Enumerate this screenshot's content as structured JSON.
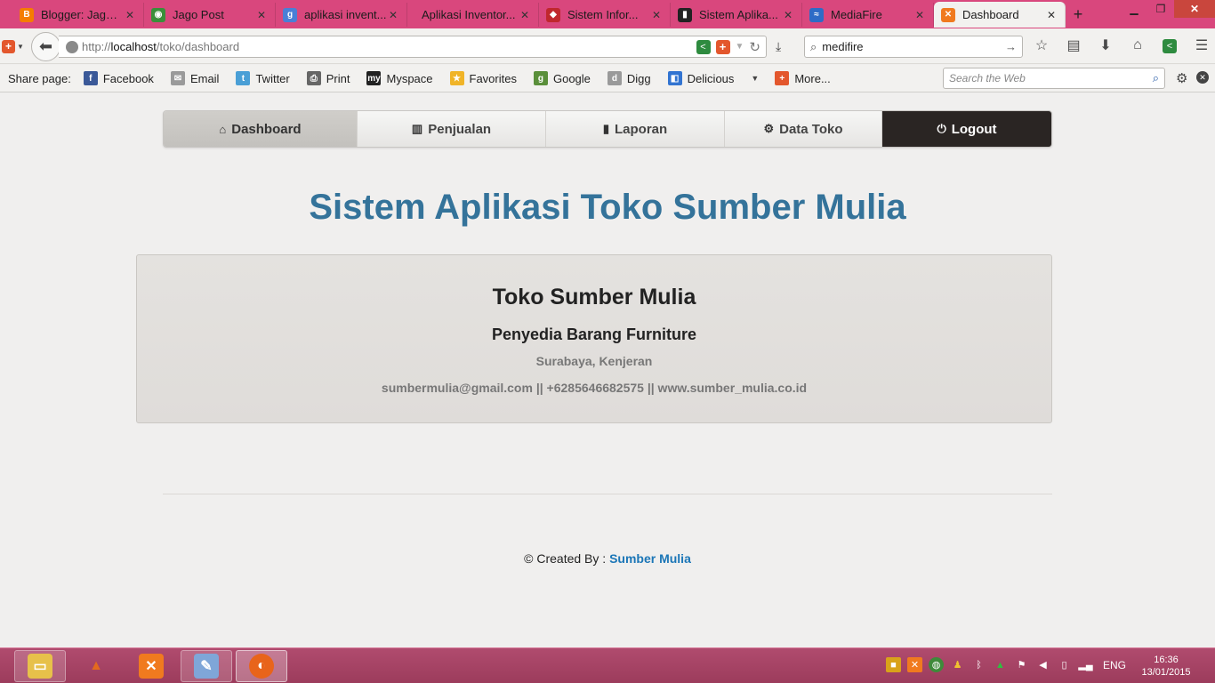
{
  "browser": {
    "tabs": [
      {
        "title": "Blogger: Jago ...",
        "icon": "blogger-icon",
        "color": "#f57d00",
        "glyph": "B"
      },
      {
        "title": "Jago Post",
        "icon": "chrome-icon",
        "color": "#3a8f3a",
        "glyph": "◉"
      },
      {
        "title": "aplikasi invent...",
        "icon": "google-icon",
        "color": "#4a7fd6",
        "glyph": "g"
      },
      {
        "title": "Aplikasi Inventor...",
        "icon": "none",
        "color": "",
        "glyph": ""
      },
      {
        "title": "Sistem Infor...",
        "icon": "site-icon",
        "color": "#c0272d",
        "glyph": "◆"
      },
      {
        "title": "Sistem Aplika...",
        "icon": "site-icon",
        "color": "#222222",
        "glyph": "▮"
      },
      {
        "title": "MediaFire",
        "icon": "mediafire-icon",
        "color": "#2e6bc6",
        "glyph": "≈"
      },
      {
        "title": "Dashboard",
        "icon": "xampp-icon",
        "color": "#f07a1f",
        "glyph": "✕"
      }
    ],
    "url_prefix": "http://",
    "url_host": "localhost",
    "url_path": "/toko/dashboard",
    "search_value": "medifire"
  },
  "sharebar": {
    "label": "Share page:",
    "items": [
      {
        "label": "Facebook",
        "icon": "facebook-icon",
        "color": "#3b5998",
        "glyph": "f"
      },
      {
        "label": "Email",
        "icon": "email-icon",
        "color": "#9a9a9a",
        "glyph": "✉"
      },
      {
        "label": "Twitter",
        "icon": "twitter-icon",
        "color": "#4a9fd6",
        "glyph": "t"
      },
      {
        "label": "Print",
        "icon": "print-icon",
        "color": "#666666",
        "glyph": "⎙"
      },
      {
        "label": "Myspace",
        "icon": "myspace-icon",
        "color": "#222222",
        "glyph": "my"
      },
      {
        "label": "Favorites",
        "icon": "star-icon",
        "color": "#f0b428",
        "glyph": "★"
      },
      {
        "label": "Google",
        "icon": "google-icon",
        "color": "#5a8f3a",
        "glyph": "g"
      },
      {
        "label": "Digg",
        "icon": "digg-icon",
        "color": "#9a9a9a",
        "glyph": "d"
      },
      {
        "label": "Delicious",
        "icon": "delicious-icon",
        "color": "#3274d1",
        "glyph": "◧"
      }
    ],
    "more_label": "More...",
    "web_search_placeholder": "Search the Web"
  },
  "menu": {
    "dashboard": "Dashboard",
    "penjualan": "Penjualan",
    "laporan": "Laporan",
    "data_toko": "Data Toko",
    "logout": "Logout"
  },
  "page": {
    "title": "Sistem Aplikasi Toko Sumber Mulia",
    "store_name": "Toko Sumber Mulia",
    "tagline": "Penyedia Barang Furniture",
    "address": "Surabaya, Kenjeran",
    "contact": "sumbermulia@gmail.com || +6285646682575 || www.sumber_mulia.co.id",
    "footer_prefix": "© Created By :",
    "footer_author": "Sumber Mulia"
  },
  "taskbar": {
    "language": "ENG",
    "time": "16:36",
    "date": "13/01/2015"
  },
  "colors": {
    "title": "#34739a",
    "footer_link": "#1b76b7",
    "logout_bg": "#2a2523",
    "tabbar": "#d9477d"
  }
}
